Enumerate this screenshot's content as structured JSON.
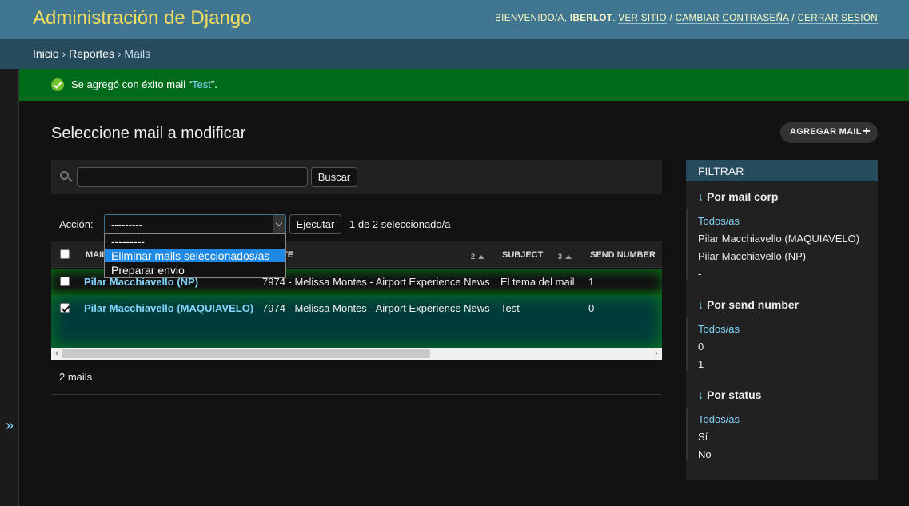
{
  "header": {
    "branding": "Administración de Django",
    "welcome_prefix": "Bienvenido/a,",
    "username": "iberlot",
    "view_site": "Ver sitio",
    "change_password": "Cambiar contraseña",
    "logout": "Cerrar sesión",
    "sep1": ".",
    "sep2": "/",
    "sep3": "/"
  },
  "breadcrumbs": [
    "Inicio",
    "Reportes",
    "Mails"
  ],
  "breadcrumb_sep": "›",
  "nav_toggle": "»",
  "message": {
    "prefix": "Se agregó con éxito mail “",
    "link": "Test",
    "suffix": "”."
  },
  "page": {
    "title": "Seleccione mail a modificar",
    "add_button": "Agregar mail",
    "add_icon": "+"
  },
  "search": {
    "value": "",
    "placeholder": "",
    "button": "Buscar"
  },
  "actions": {
    "label": "Acción:",
    "selected": "---------",
    "run_button": "Ejecutar",
    "counter": "1 de 2 seleccionado/a",
    "options": [
      "---------",
      "Eliminar mails seleccionados/as",
      "Preparar envio"
    ],
    "highlighted_index": 1
  },
  "table": {
    "headers": [
      "Mail",
      "Reporte",
      "Subject",
      "Send number"
    ],
    "header_partial_0": "MAIL",
    "header_partial_1": "TE",
    "sort_nums": [
      "2",
      "3"
    ],
    "rows": [
      {
        "checked": false,
        "mail": "Pilar Macchiavello (NP)",
        "reporte": "7974 - Melissa Montes - Airport Experience News",
        "subject": "El tema del mail",
        "send_number": "1"
      },
      {
        "checked": true,
        "mail": "Pilar Macchiavello (MAQUIAVELO)",
        "reporte": "7974 - Melissa Montes - Airport Experience News",
        "subject": "Test",
        "send_number": "0"
      }
    ]
  },
  "paginator": "2 mails",
  "filter": {
    "title": "Filtrar",
    "arrow": "↓",
    "groups": [
      {
        "heading": "Por mail corp",
        "options": [
          "Todos/as",
          "Pilar Macchiavello (MAQUIAVELO)",
          "Pilar Macchiavello (NP)",
          "-"
        ]
      },
      {
        "heading": "Por send number",
        "options": [
          "Todos/as",
          "0",
          "1"
        ]
      },
      {
        "heading": "Por status",
        "options": [
          "Todos/as",
          "Sí",
          "No"
        ]
      }
    ]
  },
  "colors": {
    "header_bg": "#417690",
    "branding": "#f5dd5d",
    "breadcrumbs_bg": "#264b5d",
    "success_bg": "#006b1b",
    "link": "#81d4fa",
    "selected_row": "#003b3b",
    "dropdown_highlight": "#1e88e5"
  }
}
